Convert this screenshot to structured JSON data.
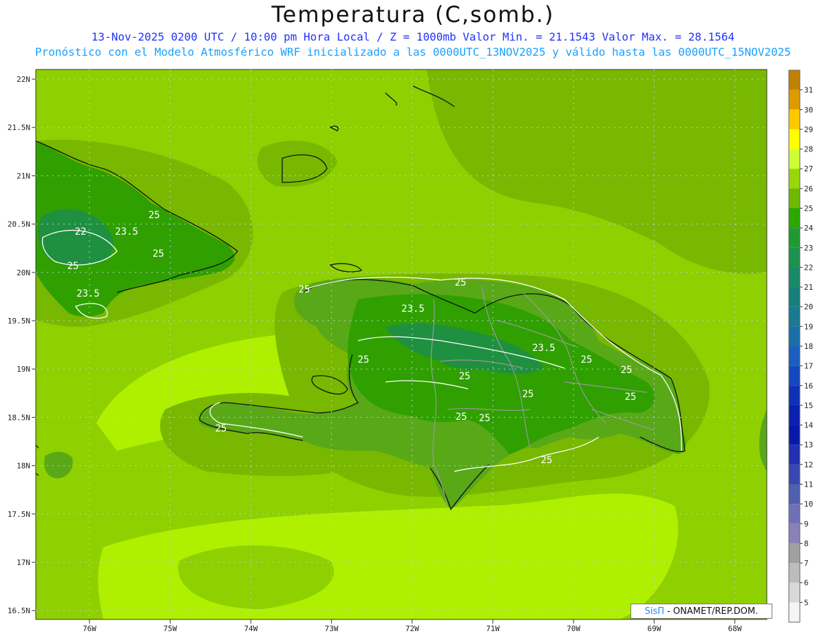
{
  "header": {
    "title": "Temperatura (C,somb.)",
    "subtitle1": "13-Nov-2025 0200 UTC / 10:00 pm Hora Local / Z = 1000mb   Valor Min. = 21.1543  Valor Max. = 28.1564",
    "subtitle2": "Pronóstico con el Modelo Atmosférico WRF inicializado a las 0000UTC_13NOV2025 y válido hasta las  0000UTC_15NOV2025"
  },
  "axes": {
    "lat_labels": [
      "22N",
      "21.5N",
      "21N",
      "20.5N",
      "20N",
      "19.5N",
      "19N",
      "18.5N",
      "18N",
      "17.5N",
      "17N",
      "16.5N"
    ],
    "lon_labels": [
      "76W",
      "75W",
      "74W",
      "73W",
      "72W",
      "71W",
      "70W",
      "69W",
      "68W"
    ]
  },
  "contour_labels": [
    "22",
    "23.5",
    "25",
    "25",
    "25",
    "23.5",
    "25",
    "25",
    "23.5",
    "23.5",
    "25",
    "25",
    "25",
    "25",
    "25",
    "25",
    "25",
    "25",
    "25",
    "25"
  ],
  "colorbar": {
    "labels": [
      "31",
      "30",
      "29",
      "28",
      "27",
      "26",
      "25",
      "24",
      "23",
      "22",
      "21",
      "20",
      "19",
      "18",
      "17",
      "16",
      "15",
      "14",
      "13",
      "12",
      "11",
      "10",
      "9",
      "8",
      "7",
      "6",
      "5"
    ],
    "colors": [
      "#c08000",
      "#e09a00",
      "#ffc800",
      "#ffff00",
      "#ccff33",
      "#99d60a",
      "#6fb800",
      "#2aa800",
      "#1e9a30",
      "#1e9050",
      "#198a68",
      "#17807a",
      "#1a7a90",
      "#1a6fa8",
      "#1a5fc0",
      "#1448c0",
      "#1030b8",
      "#0a20b0",
      "#0818a8",
      "#2030b0",
      "#3848b0",
      "#5060b0",
      "#7070b8",
      "#8c80b8",
      "#a0a0a0",
      "#bcbcbc",
      "#d8d8d8",
      "#f5f5f5"
    ]
  },
  "colors": {
    "sea_base": "#8ed000",
    "warm_band": "#aef000",
    "cool_sea": "#78b800",
    "land": "#58a818",
    "land_cool": "#2fa000",
    "land_coolest": "#1e9040"
  },
  "credit": {
    "brand": "SisΠ",
    "text": "- ONAMET/REP.DOM."
  }
}
